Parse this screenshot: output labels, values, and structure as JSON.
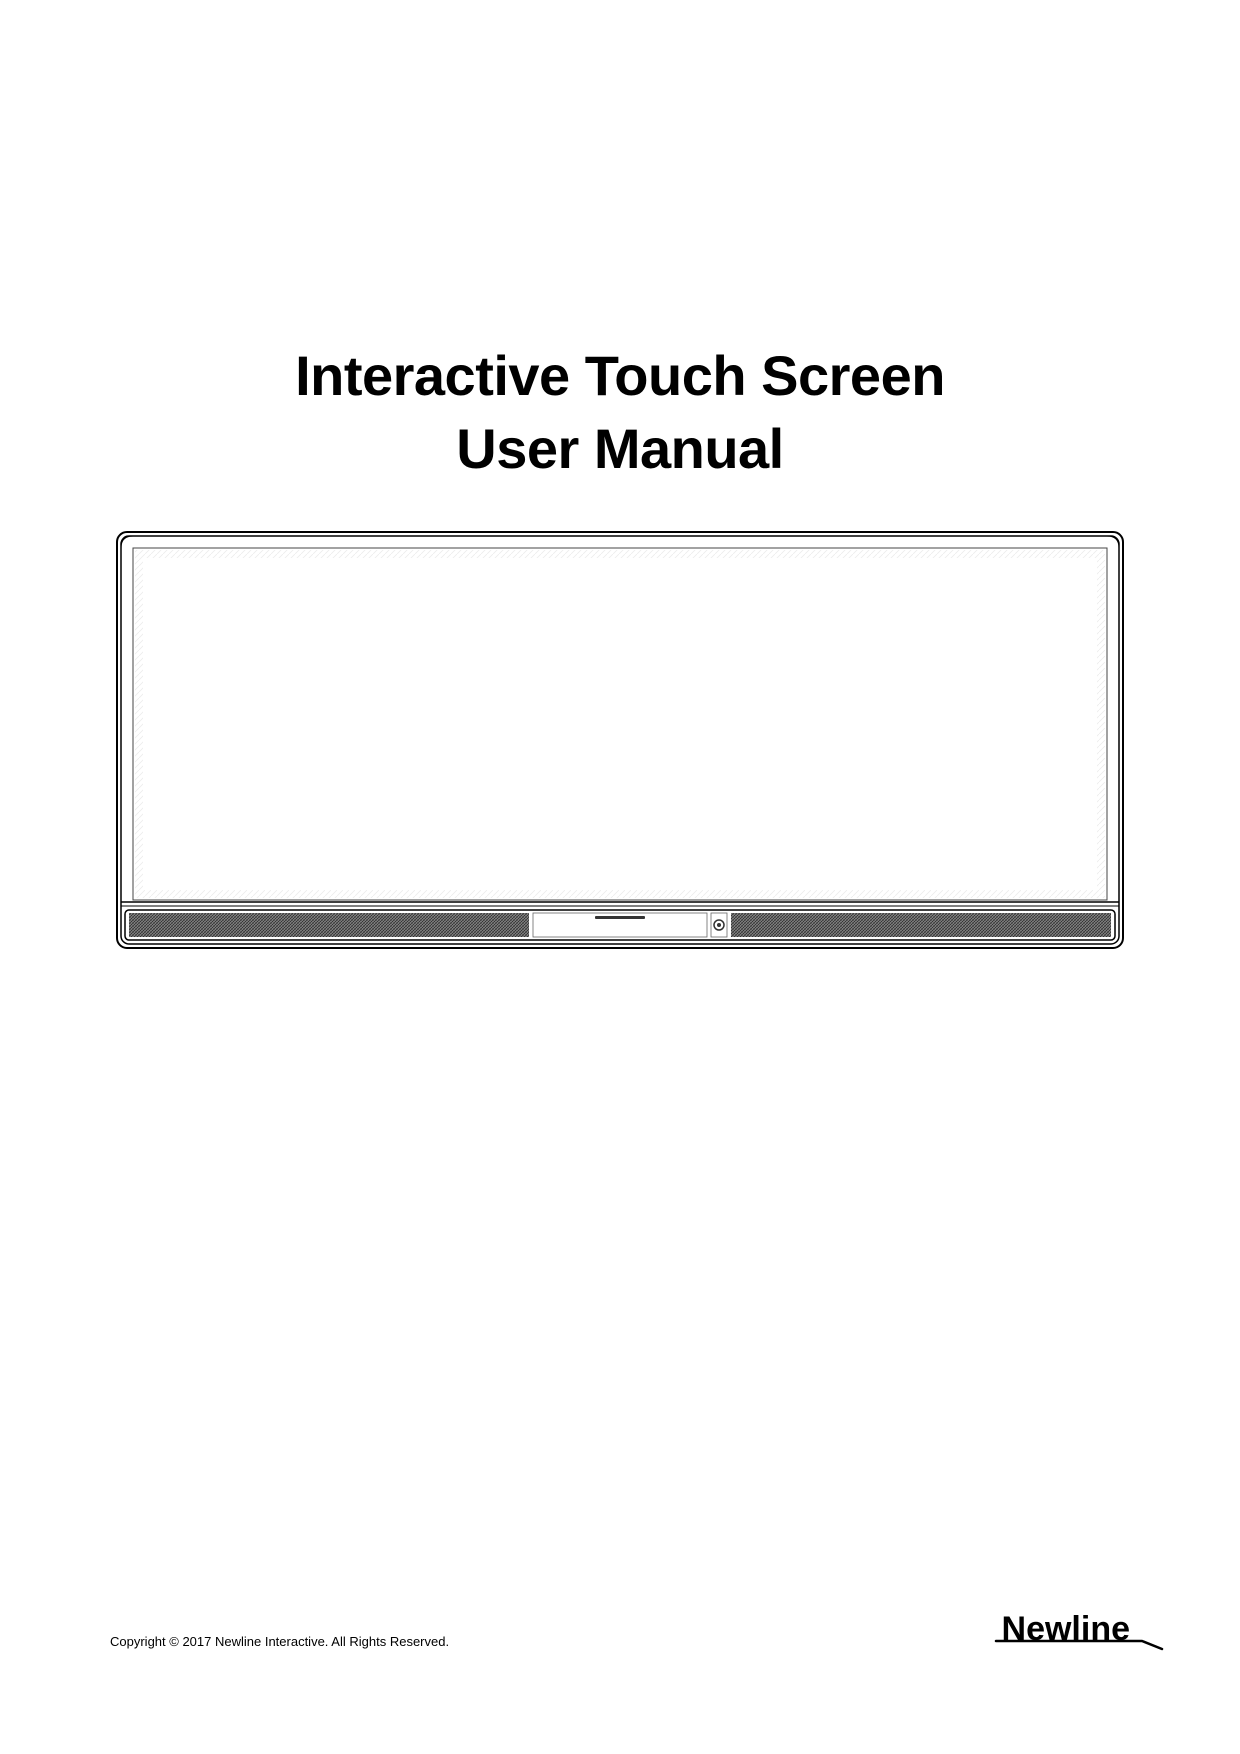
{
  "title": {
    "line1": "Interactive Touch Screen",
    "line2": "User Manual"
  },
  "footer": {
    "copyright": "Copyright © 2017 Newline Interactive. All Rights Reserved.",
    "brand": "Newline"
  }
}
